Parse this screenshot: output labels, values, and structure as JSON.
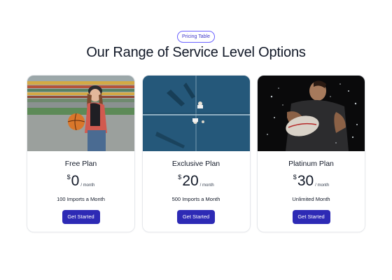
{
  "header": {
    "tag": "Pricing Table",
    "title": "Our Range of Service Level Options"
  },
  "plans": [
    {
      "name": "Free Plan",
      "currency": "$",
      "amount": "0",
      "period": "/ month",
      "imports": "100 Imports a Month",
      "cta": "Get Started",
      "image": "woman-with-basketball-photo"
    },
    {
      "name": "Exclusive Plan",
      "currency": "$",
      "amount": "20",
      "period": "/ month",
      "imports": "500 Imports a Month",
      "cta": "Get Started",
      "image": "padel-court-aerial-photo"
    },
    {
      "name": "Platinum Plan",
      "currency": "$",
      "amount": "30",
      "period": "/ month",
      "imports": "Unlimited Month",
      "cta": "Get Started",
      "image": "rugby-player-splash-photo"
    }
  ],
  "colors": {
    "accent": "#2d2ab5",
    "tag_border": "#6b63ff",
    "card_border": "#e5e7eb"
  }
}
